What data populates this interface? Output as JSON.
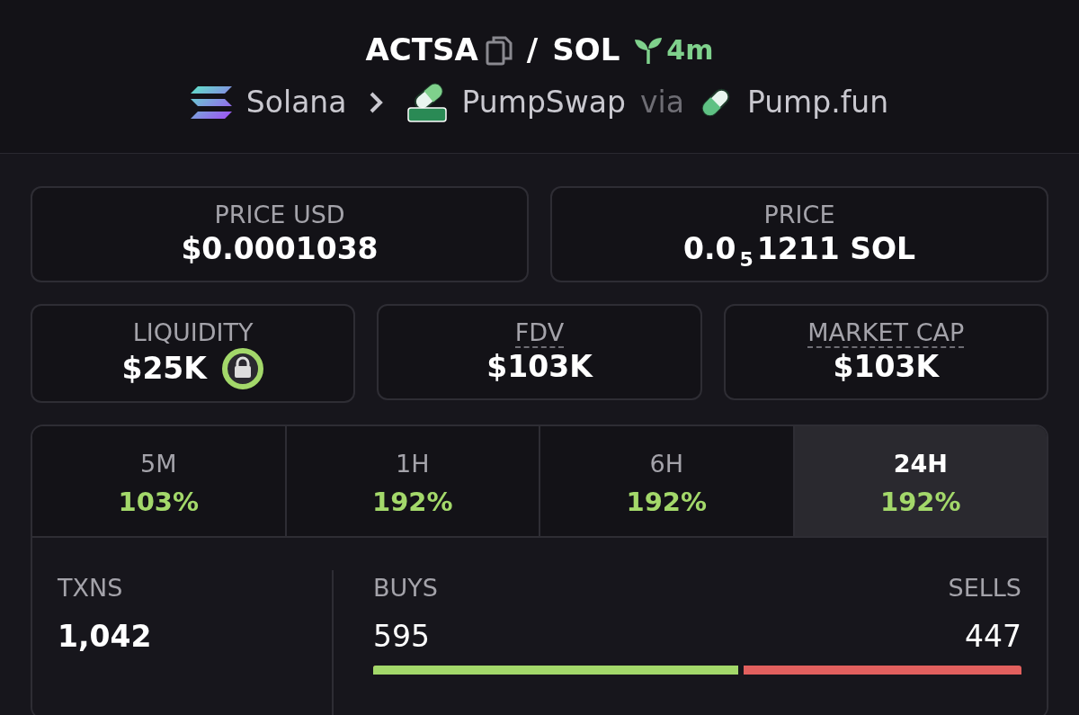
{
  "header": {
    "base": "ACTSA",
    "separator": "/",
    "quote": "SOL",
    "age": "4m",
    "chain": "Solana",
    "dex": "PumpSwap",
    "via": "via",
    "launchpad": "Pump.fun"
  },
  "price_cards": [
    {
      "label": "PRICE USD",
      "value": "$0.0001038"
    },
    {
      "label": "PRICE",
      "value": "0.0$_{5}$1211 SOL"
    }
  ],
  "stat_cards": [
    {
      "label": "LIQUIDITY",
      "value": "$25K",
      "dashed": false,
      "locked": true
    },
    {
      "label": "FDV",
      "value": "$103K",
      "dashed": true,
      "locked": false
    },
    {
      "label": "MARKET CAP",
      "value": "$103K",
      "dashed": true,
      "locked": false
    }
  ],
  "timeframes": [
    {
      "label": "5M",
      "change": "103%",
      "selected": false
    },
    {
      "label": "1H",
      "change": "192%",
      "selected": false
    },
    {
      "label": "6H",
      "change": "192%",
      "selected": false
    },
    {
      "label": "24H",
      "change": "192%",
      "selected": true
    }
  ],
  "txns": {
    "label": "TXNS",
    "value": "1,042",
    "buys_label": "BUYS",
    "buys": "595",
    "sells_label": "SELLS",
    "sells": "447",
    "level": 0.571
  }
}
